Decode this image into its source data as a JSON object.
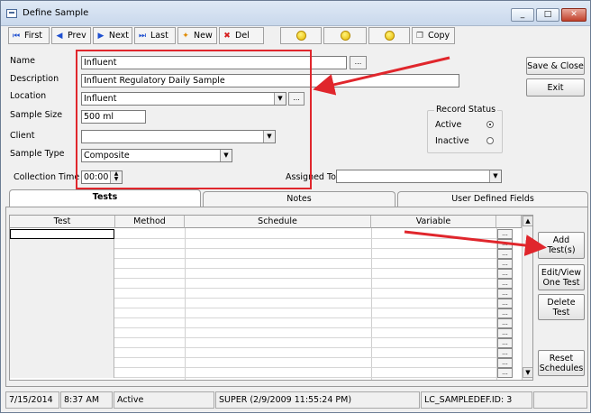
{
  "window": {
    "title": "Define Sample",
    "minimize_label": "_",
    "maximize_label": "□",
    "close_label": "✕"
  },
  "toolbar": {
    "first": "First",
    "prev": "Prev",
    "next": "Next",
    "last": "Last",
    "new": "New",
    "del": "Del",
    "copy": "Copy"
  },
  "form": {
    "name_label": "Name",
    "name_value": "Influent",
    "description_label": "Description",
    "description_value": "Influent Regulatory Daily Sample",
    "location_label": "Location",
    "location_value": "Influent",
    "sample_size_label": "Sample Size",
    "sample_size_value": "500 ml",
    "client_label": "Client",
    "client_value": "",
    "sample_type_label": "Sample Type",
    "sample_type_value": "Composite",
    "collection_time_label": "Collection Time",
    "collection_time_value": "00:00",
    "assigned_to_label": "Assigned To",
    "assigned_to_value": "",
    "ellipsis": "..."
  },
  "record_status": {
    "title": "Record Status",
    "active": "Active",
    "inactive": "Inactive",
    "selected": "Active"
  },
  "actions": {
    "save_close": "Save & Close",
    "exit": "Exit"
  },
  "tabs": [
    {
      "label": "Tests"
    },
    {
      "label": "Notes"
    },
    {
      "label": "User Defined Fields"
    }
  ],
  "grid": {
    "columns": [
      "Test",
      "Method",
      "Schedule",
      "Variable"
    ],
    "row_count": 15
  },
  "side_buttons": {
    "add_tests": "Add Test(s)",
    "edit_view": "Edit/View One Test",
    "delete_test": "Delete Test",
    "reset_schedules": "Reset Schedules"
  },
  "statusbar": {
    "date": "7/15/2014",
    "time": "8:37 AM",
    "state": "Active",
    "user": "SUPER (2/9/2009 11:55:24 PM)",
    "record_id": "LC_SAMPLEDEF.ID: 3"
  },
  "colors": {
    "annotation": "#e0262c",
    "nav_icon": "#1e4fd0"
  }
}
